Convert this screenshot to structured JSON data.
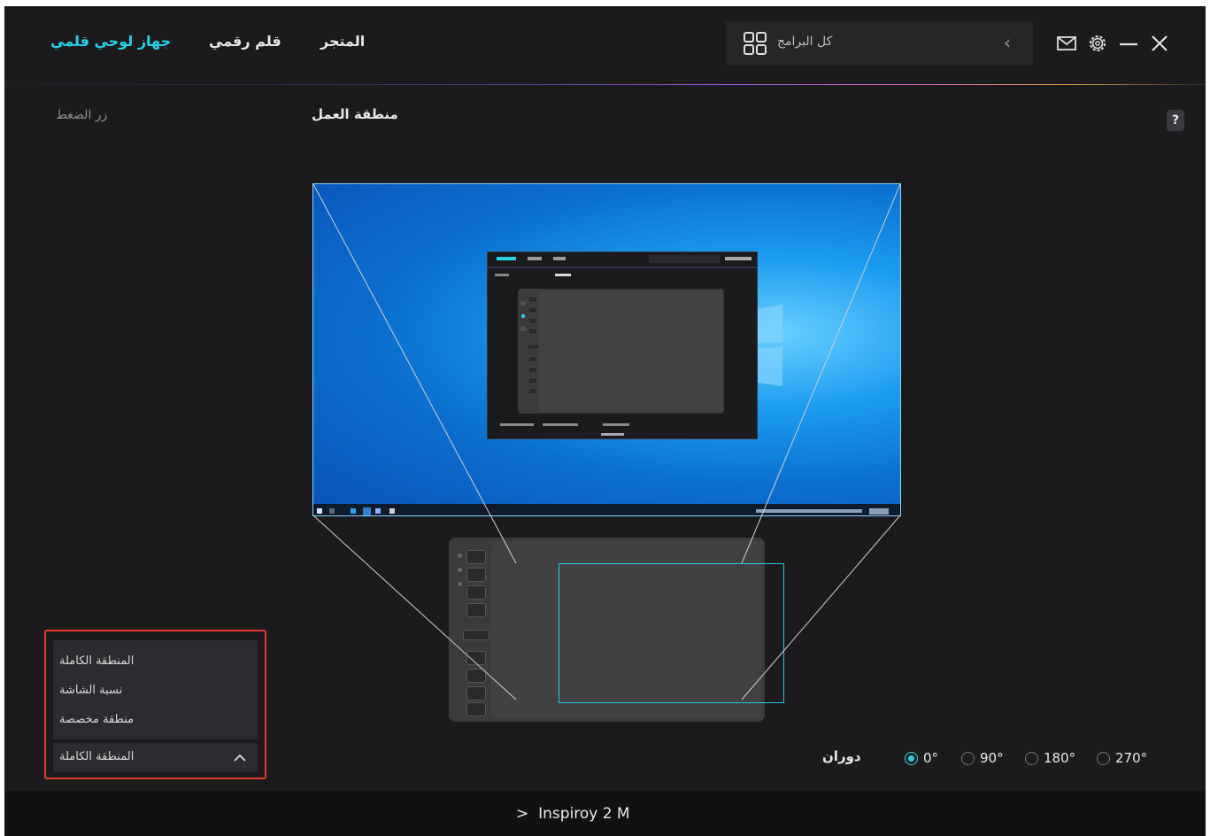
{
  "nav": {
    "tab_device": "جهاز لوحي قلمي",
    "tab_pen": "قلم رقمي",
    "tab_store": "المتجر"
  },
  "search": {
    "label": "كل البرامج"
  },
  "sub": {
    "pressure_button": "زر الضغط",
    "work_area": "منطقة العمل",
    "help": "?"
  },
  "mapping": {
    "options": [
      "المنطقة الكاملة",
      "نسبة الشاشة",
      "منطقة مخصصة"
    ],
    "selected": "المنطقة الكاملة"
  },
  "rotation": {
    "label": "دوران",
    "options": [
      "0°",
      "90°",
      "180°",
      "270°"
    ],
    "selected": "0°"
  },
  "device": {
    "name": "Inspiroy 2 M",
    "chevron": ">"
  },
  "colors": {
    "accent": "#26d3e6",
    "background": "#1b1b1e",
    "highlight_outline": "#e23b2e"
  }
}
